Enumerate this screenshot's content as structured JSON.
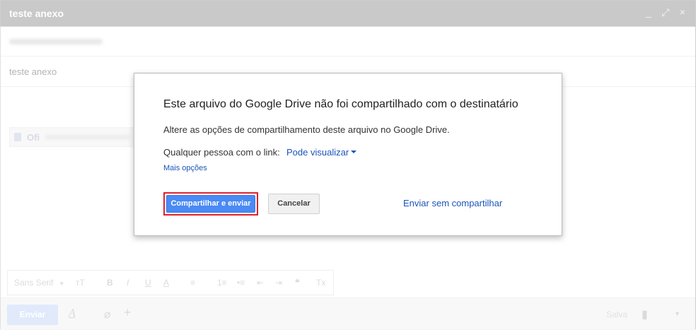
{
  "compose": {
    "title": "teste anexo",
    "window_controls": {
      "minimize": "_",
      "popout": "⤢",
      "close": "×"
    },
    "subject": "teste anexo",
    "attachment_label": "Ofi"
  },
  "format_toolbar": {
    "font": "Sans Serif",
    "items": [
      "тT",
      "B",
      "I",
      "U",
      "A",
      "≡",
      "1≡",
      "•≡",
      "⇤",
      "⇥",
      "❝",
      "Tx"
    ]
  },
  "bottom_bar": {
    "send_label": "Enviar",
    "saved_label": "Salva"
  },
  "dialog": {
    "heading": "Este arquivo do Google Drive não foi compartilhado com o destinatário",
    "body": "Altere as opções de compartilhamento deste arquivo no Google Drive.",
    "link_label": "Qualquer pessoa com o link:",
    "permission": "Pode visualizar",
    "more_options": "Mais opções",
    "share_send_label": "Compartilhar e enviar",
    "cancel_label": "Cancelar",
    "send_without_label": "Enviar sem compartilhar"
  },
  "colors": {
    "primary_button": "#4a8af4",
    "highlight_border": "#e0202a",
    "link": "#1a55b8",
    "titlebar": "#c9c9c9"
  }
}
